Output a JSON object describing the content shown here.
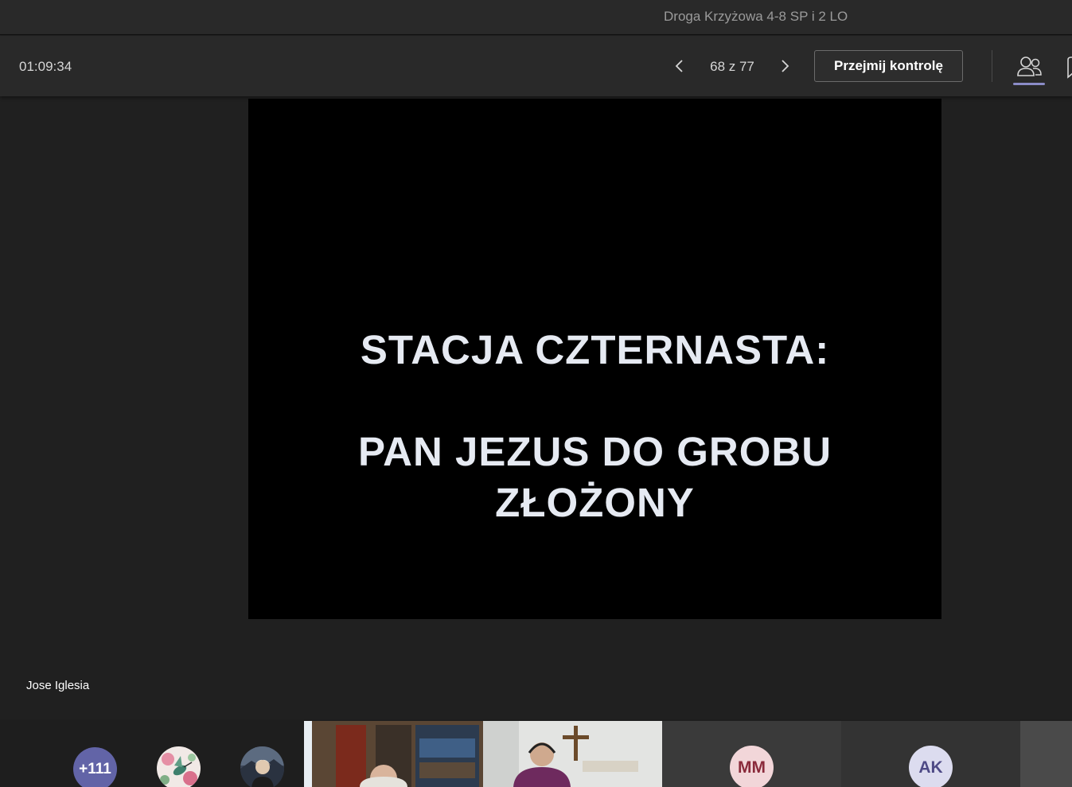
{
  "window": {
    "title": "Droga Krzyżowa 4-8 SP i 2 LO"
  },
  "toolbar": {
    "timer": "01:09:34",
    "page_indicator": "68 z 77",
    "take_control_label": "Przejmij kontrolę",
    "active_panel": "people"
  },
  "slide": {
    "line1": "STACJA CZTERNASTA:",
    "line2": "PAN JEZUS DO GROBU",
    "line3": "ZŁOŻONY"
  },
  "presenter": {
    "name": "Jose Iglesia"
  },
  "participants": {
    "overflow_count": "+111",
    "tiles": [
      {
        "initials": "MM",
        "color": "#f2d6d9"
      },
      {
        "initials": "AK",
        "color": "#dcdcef"
      }
    ]
  },
  "colors": {
    "accent": "#6264a7",
    "background": "#202020",
    "toolbar": "#292929",
    "slide_text": "#e6eaf2"
  }
}
